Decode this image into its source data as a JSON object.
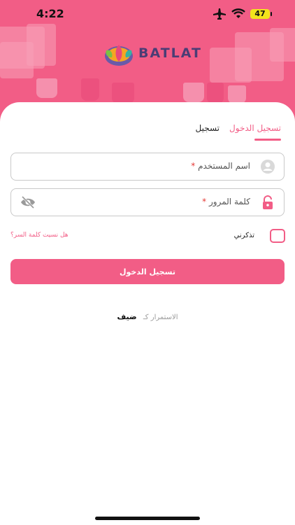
{
  "status_bar": {
    "time": "4:22",
    "battery": "47"
  },
  "brand": {
    "name": "BATLAT"
  },
  "tabs": [
    {
      "label": "تسجيل الدخول",
      "active": true
    },
    {
      "label": "تسجيل",
      "active": false
    }
  ],
  "form": {
    "username_label": "اسم المستخدم",
    "password_label": "كلمة المرور",
    "required_mark": "*",
    "remember_label": "تذكرني",
    "forgot_link": "هل نسيت كلمة السر؟",
    "submit_label": "تسجيل الدخول"
  },
  "guest": {
    "prefix": "الاستمرار كـ",
    "link": "ضيف"
  },
  "colors": {
    "accent": "#f25d86",
    "brand_text": "#4b3d75"
  },
  "icons": [
    "airplane-icon",
    "wifi-icon",
    "battery-icon",
    "user-icon",
    "lock-icon",
    "eye-off-icon"
  ]
}
